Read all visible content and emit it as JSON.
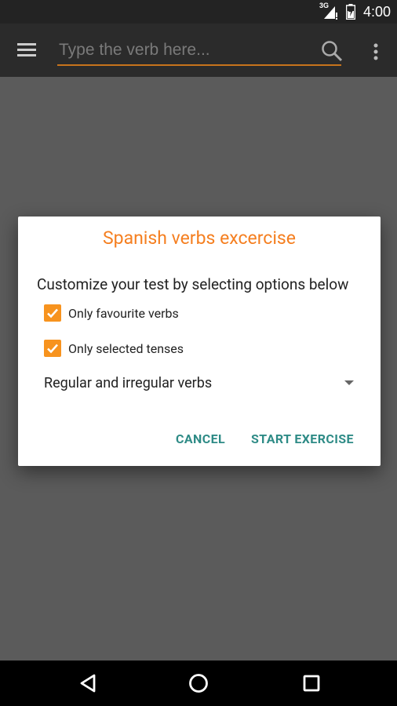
{
  "status_bar": {
    "network_label": "3G",
    "time": "4:00"
  },
  "toolbar": {
    "search_placeholder": "Type the verb here..."
  },
  "dialog": {
    "title": "Spanish verbs excercise",
    "subtitle": "Customize your test by selecting options below",
    "options": [
      {
        "label": "Only favourite verbs",
        "checked": true
      },
      {
        "label": "Only selected tenses",
        "checked": true
      }
    ],
    "verb_type_selected": "Regular and irregular verbs",
    "cancel_label": "CANCEL",
    "start_label": "START EXERCISE"
  },
  "colors": {
    "accent": "#f57f20",
    "checkbox": "#f7931e",
    "button_text": "#2e8b86",
    "toolbar": "#2b2b2b",
    "scrim": "#5b5b5b"
  }
}
